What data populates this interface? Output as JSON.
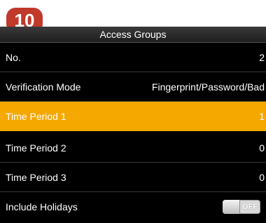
{
  "badge": "10",
  "window": {
    "title": "Access Groups"
  },
  "rows": [
    {
      "label": "No.",
      "value": "2"
    },
    {
      "label": "Verification Mode",
      "value": "Fingerprint/Password/Bad"
    },
    {
      "label": "Time Period 1",
      "value": "1",
      "selected": true
    },
    {
      "label": "Time Period 2",
      "value": "0"
    },
    {
      "label": "Time Period 3",
      "value": "0"
    },
    {
      "label": "Include Holidays",
      "toggle": "OFF"
    }
  ],
  "colors": {
    "selected": "#f5a800",
    "background": "#000000",
    "badge": "#c0392b"
  }
}
